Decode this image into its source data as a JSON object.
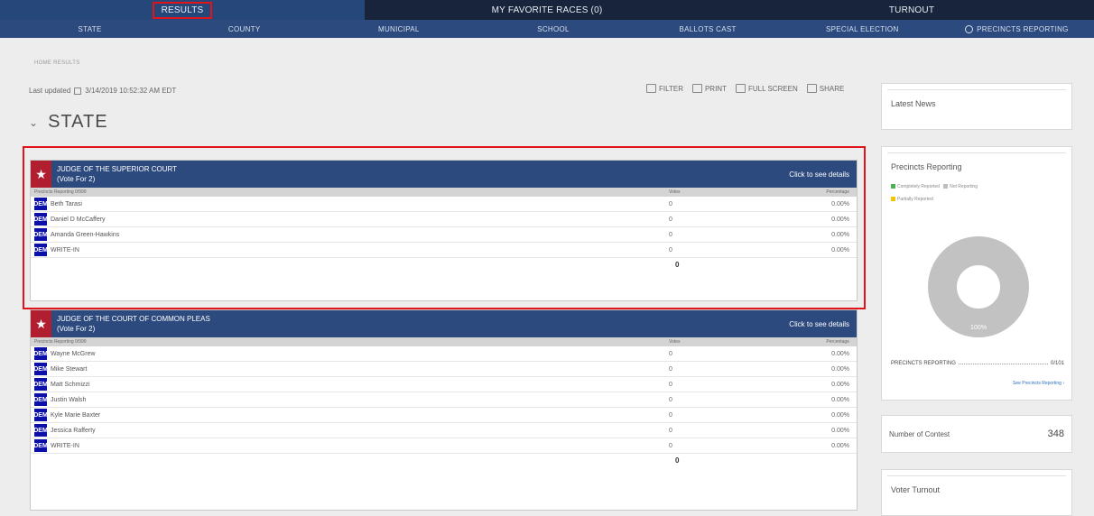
{
  "topnav": {
    "tabs": [
      "RESULTS",
      "MY FAVORITE RACES (0)",
      "TURNOUT"
    ]
  },
  "subnav": {
    "items": [
      "STATE",
      "COUNTY",
      "MUNICIPAL",
      "SCHOOL",
      "BALLOTS CAST",
      "SPECIAL ELECTION",
      "PRECINCTS REPORTING"
    ]
  },
  "breadcrumb": "HOME RESULTS",
  "updated": {
    "label": "Last updated",
    "value": "3/14/2019 10:52:32 AM EDT"
  },
  "toolbar": {
    "filter": "Filter",
    "print": "PRINT",
    "fullscreen": "FULL SCREEN",
    "share": "SHARE"
  },
  "page_title": "STATE",
  "races": [
    {
      "title": "JUDGE OF THE SUPERIOR COURT",
      "vote_for": "(Vote For 2)",
      "details": "Click to see details",
      "col_precincts": "Precincts Reporting 0/999",
      "col_votes": "Votes",
      "col_pct": "Percentage",
      "candidates": [
        {
          "party": "DEM",
          "name": "Beth Tarasi",
          "votes": "0",
          "pct": "0.00%"
        },
        {
          "party": "DEM",
          "name": "Daniel D McCaffery",
          "votes": "0",
          "pct": "0.00%"
        },
        {
          "party": "DEM",
          "name": "Amanda Green-Hawkins",
          "votes": "0",
          "pct": "0.00%"
        },
        {
          "party": "DEM",
          "name": "WRITE-IN",
          "votes": "0",
          "pct": "0.00%"
        }
      ],
      "total": "0"
    },
    {
      "title": "JUDGE OF THE COURT OF COMMON PLEAS",
      "vote_for": "(Vote For 2)",
      "details": "Click to see details",
      "col_precincts": "Precincts Reporting 0/999",
      "col_votes": "Votes",
      "col_pct": "Percentage",
      "candidates": [
        {
          "party": "DEM",
          "name": "Wayne McGrew",
          "votes": "0",
          "pct": "0.00%"
        },
        {
          "party": "DEM",
          "name": "Mike Stewart",
          "votes": "0",
          "pct": "0.00%"
        },
        {
          "party": "DEM",
          "name": "Matt Schmizzi",
          "votes": "0",
          "pct": "0.00%"
        },
        {
          "party": "DEM",
          "name": "Justin Walsh",
          "votes": "0",
          "pct": "0.00%"
        },
        {
          "party": "DEM",
          "name": "Kyle Marie Baxter",
          "votes": "0",
          "pct": "0.00%"
        },
        {
          "party": "DEM",
          "name": "Jessica Rafferty",
          "votes": "0",
          "pct": "0.00%"
        },
        {
          "party": "DEM",
          "name": "WRITE-IN",
          "votes": "0",
          "pct": "0.00%"
        }
      ],
      "total": "0"
    }
  ],
  "sidebar": {
    "latest_news": "Latest News",
    "precincts": {
      "title": "Precincts Reporting",
      "legend": [
        "Completely Reported",
        "Not Reporting",
        "Partially Reported"
      ],
      "legend_colors": [
        "#4caf50",
        "#bdbdbd",
        "#f5c400"
      ],
      "donut_label": "100%",
      "reporting_label": "PRECINCTS REPORTING",
      "reporting_value": "0/101",
      "see_link": "See Precincts Reporting"
    },
    "contest": {
      "label": "Number of Contest",
      "value": "348"
    },
    "turnout": {
      "label": "Voter Turnout"
    }
  },
  "colors": {
    "nav_dark": "#17243c",
    "nav": "#2c4a7e",
    "race_header": "#2c4a7e",
    "star": "#b01e2f",
    "dem": "#0b10a8",
    "highlight": "#e0141a"
  }
}
